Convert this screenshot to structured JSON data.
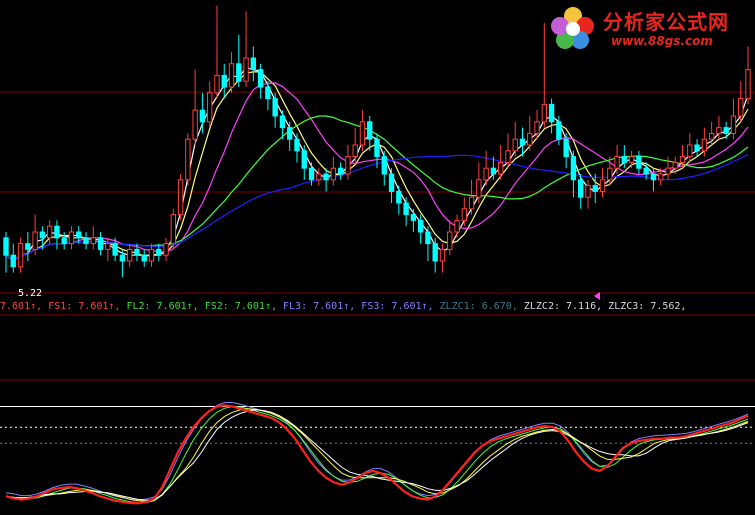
{
  "logo": {
    "cn_text": "分析家公式网",
    "url_text": "www.88gs.com"
  },
  "price_low_label": "5.22",
  "legend": [
    {
      "label": "",
      "value": "7.601",
      "arrow": "↑",
      "color": "#ff4040"
    },
    {
      "label": "FS1",
      "value": "7.601",
      "arrow": "↑",
      "color": "#ff4040"
    },
    {
      "label": "FL2",
      "value": "7.601",
      "arrow": "↑",
      "color": "#3ddc3d"
    },
    {
      "label": "FS2",
      "value": "7.601",
      "arrow": "↑",
      "color": "#3ddc3d"
    },
    {
      "label": "FL3",
      "value": "7.601",
      "arrow": "↑",
      "color": "#8080ff"
    },
    {
      "label": "FS3",
      "value": "7.601",
      "arrow": "↑",
      "color": "#8080ff"
    },
    {
      "label": "ZLZC1",
      "value": "6.670",
      "arrow": "",
      "color": "#3a7a8a"
    },
    {
      "label": "ZLZC2",
      "value": "7.116",
      "arrow": "",
      "color": "#d8d8d8"
    },
    {
      "label": "ZLZC3",
      "value": "7.562",
      "arrow": "",
      "color": "#d8d8d8"
    }
  ],
  "colors": {
    "background": "#000000",
    "candle_up": "#ff4040",
    "candle_down": "#00ffff",
    "grid_red": "#800000",
    "ma_white": "#ffffff",
    "ma_yellow": "#ffff80",
    "ma_magenta": "#ff40ff",
    "ma_green": "#40ff40",
    "ma_blue": "#2020ff",
    "ind_red": "#ff2020",
    "ind_blue": "#8080ff"
  },
  "chart_data": {
    "type": "candlestick",
    "price_min_label": 5.22,
    "candles": [
      [
        5.9,
        5.6,
        6.0,
        5.3
      ],
      [
        5.6,
        5.4,
        5.8,
        5.3
      ],
      [
        5.4,
        5.8,
        5.9,
        5.3
      ],
      [
        5.8,
        5.7,
        6.0,
        5.5
      ],
      [
        5.7,
        6.0,
        6.3,
        5.6
      ],
      [
        6.0,
        5.9,
        6.1,
        5.7
      ],
      [
        5.9,
        6.1,
        6.2,
        5.8
      ],
      [
        6.1,
        5.9,
        6.2,
        5.7
      ],
      [
        5.9,
        5.8,
        6.0,
        5.7
      ],
      [
        5.8,
        6.0,
        6.1,
        5.7
      ],
      [
        6.0,
        5.9,
        6.1,
        5.8
      ],
      [
        5.9,
        5.8,
        6.0,
        5.7
      ],
      [
        5.8,
        5.9,
        6.1,
        5.7
      ],
      [
        5.9,
        5.7,
        6.0,
        5.6
      ],
      [
        5.7,
        5.8,
        5.9,
        5.5
      ],
      [
        5.8,
        5.6,
        5.9,
        5.5
      ],
      [
        5.6,
        5.5,
        5.7,
        5.22
      ],
      [
        5.5,
        5.7,
        5.8,
        5.4
      ],
      [
        5.7,
        5.6,
        5.8,
        5.5
      ],
      [
        5.6,
        5.5,
        5.7,
        5.4
      ],
      [
        5.5,
        5.7,
        5.8,
        5.4
      ],
      [
        5.7,
        5.6,
        5.8,
        5.5
      ],
      [
        5.6,
        5.8,
        5.9,
        5.5
      ],
      [
        5.8,
        6.3,
        6.4,
        5.7
      ],
      [
        6.3,
        6.9,
        7.0,
        6.2
      ],
      [
        6.9,
        7.6,
        7.7,
        6.8
      ],
      [
        7.6,
        8.1,
        8.8,
        7.5
      ],
      [
        8.1,
        7.9,
        8.4,
        7.7
      ],
      [
        7.9,
        8.4,
        8.6,
        7.8
      ],
      [
        8.4,
        8.7,
        9.9,
        8.3
      ],
      [
        8.7,
        8.5,
        8.9,
        8.3
      ],
      [
        8.5,
        8.9,
        9.1,
        8.4
      ],
      [
        8.9,
        8.6,
        9.4,
        8.5
      ],
      [
        8.6,
        9.0,
        9.8,
        8.5
      ],
      [
        9.0,
        8.8,
        9.2,
        8.6
      ],
      [
        8.8,
        8.5,
        8.9,
        8.3
      ],
      [
        8.5,
        8.3,
        8.6,
        8.1
      ],
      [
        8.3,
        8.0,
        8.4,
        7.8
      ],
      [
        8.0,
        7.8,
        8.1,
        7.6
      ],
      [
        7.8,
        7.6,
        7.9,
        7.4
      ],
      [
        7.6,
        7.4,
        7.7,
        7.2
      ],
      [
        7.4,
        7.1,
        7.5,
        6.9
      ],
      [
        7.1,
        6.9,
        7.2,
        6.8
      ],
      [
        6.9,
        7.0,
        7.1,
        6.8
      ],
      [
        7.0,
        6.9,
        7.1,
        6.7
      ],
      [
        6.9,
        7.1,
        7.3,
        6.8
      ],
      [
        7.1,
        7.0,
        7.2,
        6.9
      ],
      [
        7.0,
        7.3,
        7.5,
        6.9
      ],
      [
        7.3,
        7.5,
        7.8,
        7.2
      ],
      [
        7.5,
        7.9,
        8.1,
        7.4
      ],
      [
        7.9,
        7.6,
        8.0,
        7.4
      ],
      [
        7.6,
        7.3,
        7.7,
        7.1
      ],
      [
        7.3,
        7.0,
        7.4,
        6.8
      ],
      [
        7.0,
        6.7,
        7.1,
        6.5
      ],
      [
        6.7,
        6.5,
        6.8,
        6.3
      ],
      [
        6.5,
        6.3,
        6.6,
        6.1
      ],
      [
        6.3,
        6.2,
        6.4,
        6.0
      ],
      [
        6.2,
        6.0,
        6.3,
        5.8
      ],
      [
        6.0,
        5.8,
        6.1,
        5.5
      ],
      [
        5.8,
        5.5,
        5.9,
        5.3
      ],
      [
        5.5,
        5.7,
        5.8,
        5.3
      ],
      [
        5.7,
        6.0,
        6.2,
        5.6
      ],
      [
        6.0,
        6.2,
        6.3,
        5.9
      ],
      [
        6.2,
        6.4,
        6.6,
        6.1
      ],
      [
        6.4,
        6.6,
        6.9,
        6.3
      ],
      [
        6.6,
        6.9,
        7.2,
        6.5
      ],
      [
        6.9,
        7.1,
        7.4,
        6.8
      ],
      [
        7.1,
        7.0,
        7.3,
        6.9
      ],
      [
        7.0,
        7.2,
        7.5,
        6.9
      ],
      [
        7.2,
        7.4,
        7.7,
        7.1
      ],
      [
        7.4,
        7.6,
        7.9,
        7.3
      ],
      [
        7.6,
        7.5,
        7.8,
        7.3
      ],
      [
        7.5,
        7.7,
        8.0,
        7.4
      ],
      [
        7.7,
        7.9,
        8.1,
        7.6
      ],
      [
        7.9,
        8.2,
        9.6,
        7.8
      ],
      [
        8.2,
        7.9,
        8.3,
        7.7
      ],
      [
        7.9,
        7.6,
        8.0,
        7.5
      ],
      [
        7.6,
        7.3,
        7.7,
        7.1
      ],
      [
        7.3,
        6.9,
        7.4,
        6.6
      ],
      [
        6.9,
        6.6,
        7.0,
        6.4
      ],
      [
        6.6,
        6.8,
        6.9,
        6.4
      ],
      [
        6.8,
        6.7,
        7.0,
        6.5
      ],
      [
        6.7,
        6.9,
        7.1,
        6.6
      ],
      [
        6.9,
        7.1,
        7.3,
        6.8
      ],
      [
        7.1,
        7.3,
        7.5,
        7.0
      ],
      [
        7.3,
        7.2,
        7.5,
        7.1
      ],
      [
        7.2,
        7.3,
        7.4,
        7.1
      ],
      [
        7.3,
        7.1,
        7.4,
        7.0
      ],
      [
        7.1,
        7.0,
        7.2,
        6.9
      ],
      [
        7.0,
        6.9,
        7.1,
        6.7
      ],
      [
        6.9,
        7.0,
        7.1,
        6.8
      ],
      [
        7.0,
        7.1,
        7.3,
        6.9
      ],
      [
        7.1,
        7.2,
        7.3,
        7.0
      ],
      [
        7.2,
        7.3,
        7.5,
        7.1
      ],
      [
        7.3,
        7.5,
        7.7,
        7.2
      ],
      [
        7.5,
        7.4,
        7.6,
        7.3
      ],
      [
        7.4,
        7.6,
        7.8,
        7.3
      ],
      [
        7.6,
        7.7,
        7.9,
        7.5
      ],
      [
        7.7,
        7.8,
        8.0,
        7.6
      ],
      [
        7.8,
        7.7,
        7.9,
        7.6
      ],
      [
        7.7,
        8.0,
        8.3,
        7.6
      ],
      [
        8.0,
        8.3,
        8.6,
        7.9
      ],
      [
        8.3,
        8.8,
        9.2,
        8.2
      ]
    ],
    "indicator": [
      0.12,
      0.1,
      0.09,
      0.1,
      0.12,
      0.15,
      0.18,
      0.19,
      0.2,
      0.19,
      0.17,
      0.15,
      0.12,
      0.1,
      0.08,
      0.07,
      0.06,
      0.06,
      0.07,
      0.1,
      0.2,
      0.35,
      0.5,
      0.62,
      0.72,
      0.8,
      0.86,
      0.9,
      0.91,
      0.9,
      0.88,
      0.86,
      0.84,
      0.82,
      0.8,
      0.76,
      0.7,
      0.62,
      0.52,
      0.42,
      0.34,
      0.28,
      0.24,
      0.22,
      0.24,
      0.28,
      0.32,
      0.34,
      0.32,
      0.28,
      0.22,
      0.16,
      0.12,
      0.1,
      0.09,
      0.12,
      0.18,
      0.26,
      0.34,
      0.42,
      0.5,
      0.56,
      0.6,
      0.62,
      0.64,
      0.66,
      0.68,
      0.7,
      0.72,
      0.73,
      0.72,
      0.68,
      0.6,
      0.5,
      0.42,
      0.36,
      0.34,
      0.38,
      0.46,
      0.54,
      0.58,
      0.6,
      0.61,
      0.62,
      0.62,
      0.63,
      0.63,
      0.64,
      0.66,
      0.68,
      0.7,
      0.72,
      0.74,
      0.76,
      0.79,
      0.82
    ]
  }
}
